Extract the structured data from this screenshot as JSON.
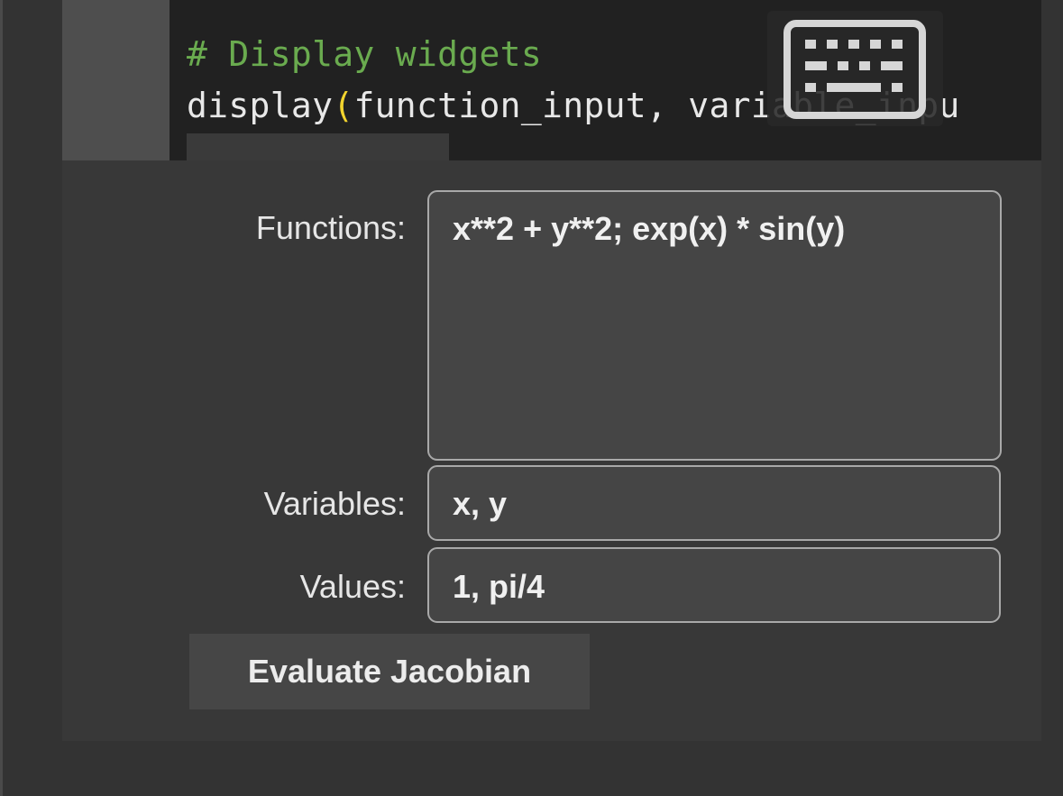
{
  "code": {
    "comment_line": "# Display widgets",
    "call_name": "display",
    "open_paren": "(",
    "call_args_visible": "function_input, variable_inpu"
  },
  "overlay": {
    "icon": "keyboard-icon"
  },
  "form": {
    "functions_label": "Functions:",
    "functions_value": "x**2 + y**2; exp(x) * sin(y)",
    "variables_label": "Variables:",
    "variables_value": "x, y",
    "values_label": "Values:",
    "values_value": "1, pi/4",
    "evaluate_button": "Evaluate Jacobian"
  },
  "colors": {
    "comment": "#6aab4f",
    "paren": "#f2d42e",
    "code_bg": "#212121",
    "cell_bg": "#383838"
  }
}
